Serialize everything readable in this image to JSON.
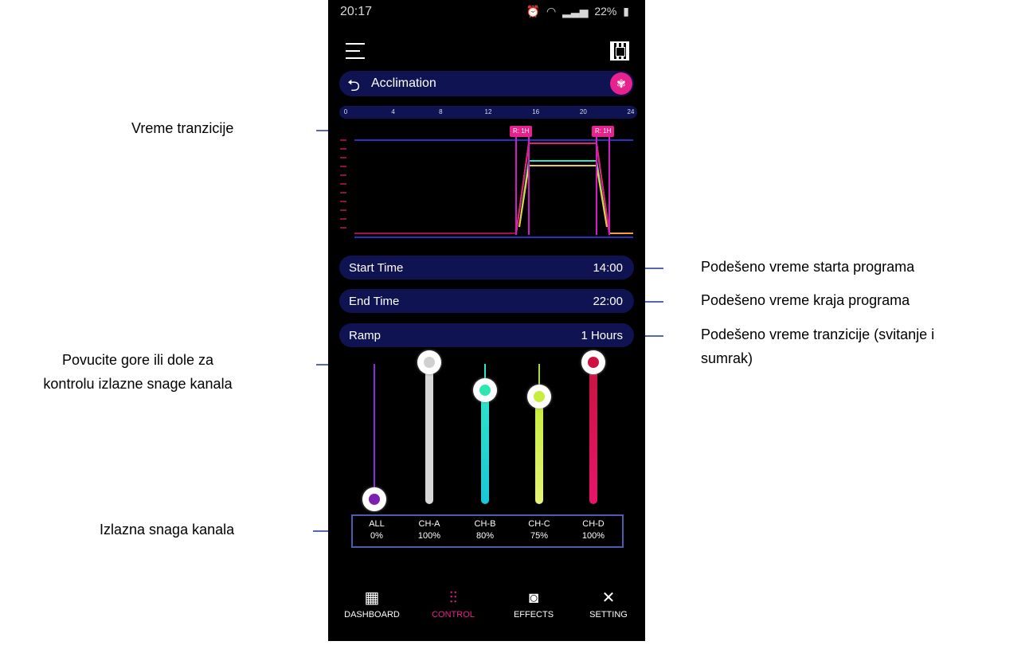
{
  "status_bar": {
    "time": "20:17",
    "battery": "22%"
  },
  "program": {
    "name": "Acclimation"
  },
  "timeline": {
    "ticks": [
      "0",
      "4",
      "8",
      "12",
      "16",
      "20",
      "24"
    ]
  },
  "ramp_tags": [
    "R: 1H",
    "R: 1H"
  ],
  "settings": [
    {
      "label": "Start Time",
      "value": "14:00"
    },
    {
      "label": "End Time",
      "value": "22:00"
    },
    {
      "label": "Ramp",
      "value": "1 Hours"
    }
  ],
  "channels": [
    {
      "name": "ALL",
      "value": "0%",
      "level": 0,
      "color": "#7e1fb3"
    },
    {
      "name": "CH-A",
      "value": "100%",
      "level": 1.0,
      "color": "#cfcfcf"
    },
    {
      "name": "CH-B",
      "value": "80%",
      "level": 0.8,
      "color": "#2ee6c4"
    },
    {
      "name": "CH-C",
      "value": "75%",
      "level": 0.75,
      "color": "#c7ee3a"
    },
    {
      "name": "CH-D",
      "value": "100%",
      "level": 1.0,
      "color": "#e0135a"
    }
  ],
  "nav": [
    {
      "label": "DASHBOARD",
      "icon": "grid-icon"
    },
    {
      "label": "CONTROL",
      "icon": "sliders-icon",
      "active": true
    },
    {
      "label": "EFFECTS",
      "icon": "bulb-icon"
    },
    {
      "label": "SETTING",
      "icon": "tools-icon"
    }
  ],
  "annotations": {
    "transition_time": "Vreme tranzicije",
    "start_time": "Podešeno vreme starta programa",
    "end_time": "Podešeno vreme kraja programa",
    "ramp_line1": "Podešeno vreme tranzicije (svitanje i",
    "ramp_line2": "sumrak)",
    "drag_line1": "Povucite gore ili dole za",
    "drag_line2": "kontrolu izlazne snage kanala",
    "output_power": "Izlazna snaga kanala"
  }
}
